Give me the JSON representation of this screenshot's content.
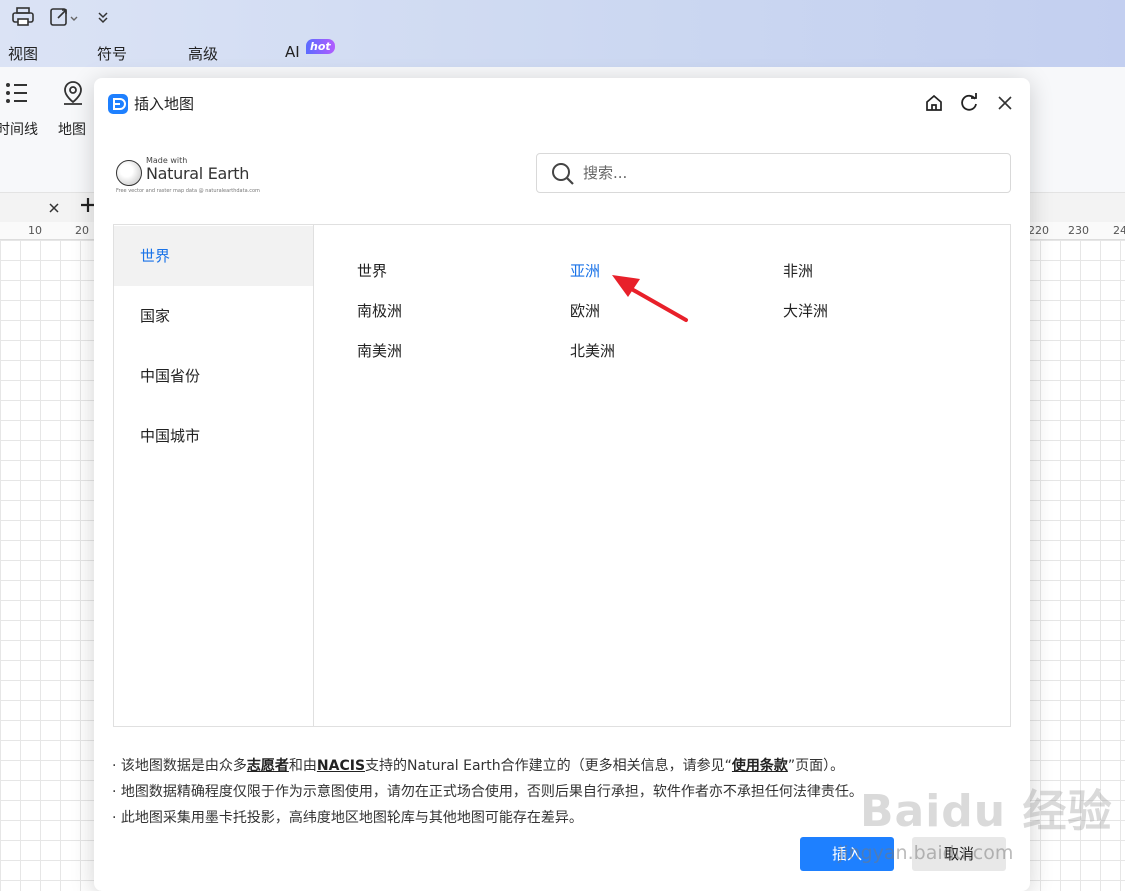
{
  "app": {
    "menu": [
      "视图",
      "符号",
      "高级",
      "AI"
    ],
    "hot_badge": "hot",
    "ribbon": {
      "timeline_label": "时间线",
      "map_label": "地图"
    },
    "ruler_ticks": [
      "10",
      "20",
      "220",
      "230",
      "24"
    ]
  },
  "dialog": {
    "title": "插入地图",
    "logo": {
      "made_with": "Made with",
      "brand": "Natural Earth",
      "tagline": "Free vector and raster map data @ naturalearthdata.com"
    },
    "search": {
      "placeholder": "搜索..."
    },
    "categories": [
      {
        "label": "世界",
        "active": true
      },
      {
        "label": "国家",
        "active": false
      },
      {
        "label": "中国省份",
        "active": false
      },
      {
        "label": "中国城市",
        "active": false
      }
    ],
    "maps": [
      {
        "label": "世界",
        "active": false
      },
      {
        "label": "亚洲",
        "active": true
      },
      {
        "label": "非洲",
        "active": false
      },
      {
        "label": "南极洲",
        "active": false
      },
      {
        "label": "欧洲",
        "active": false
      },
      {
        "label": "大洋洲",
        "active": false
      },
      {
        "label": "南美洲",
        "active": false
      },
      {
        "label": "北美洲",
        "active": false
      }
    ],
    "notes": {
      "line1_a": "· 该地图数据是由众多",
      "line1_volunteer": "志愿者",
      "line1_b": "和由",
      "line1_nacis": "NACIS",
      "line1_c": "支持的Natural Earth合作建立的（更多相关信息，请参见“",
      "line1_terms": "使用条款",
      "line1_d": "”页面）。",
      "line2": "· 地图数据精确程度仅限于作为示意图使用，请勿在正式场合使用，否则后果自行承担，软件作者亦不承担任何法律责任。",
      "line3": "· 此地图采集用墨卡托投影，高纬度地区地图轮库与其他地图可能存在差异。"
    },
    "buttons": {
      "insert": "插入",
      "cancel": "取消"
    }
  },
  "watermark": {
    "text": "Baidu 经验",
    "url": "jingyan.baidu.com"
  },
  "colors": {
    "accent": "#1e80ff",
    "selected_text": "#1a73e8",
    "arrow": "#e8202a"
  }
}
